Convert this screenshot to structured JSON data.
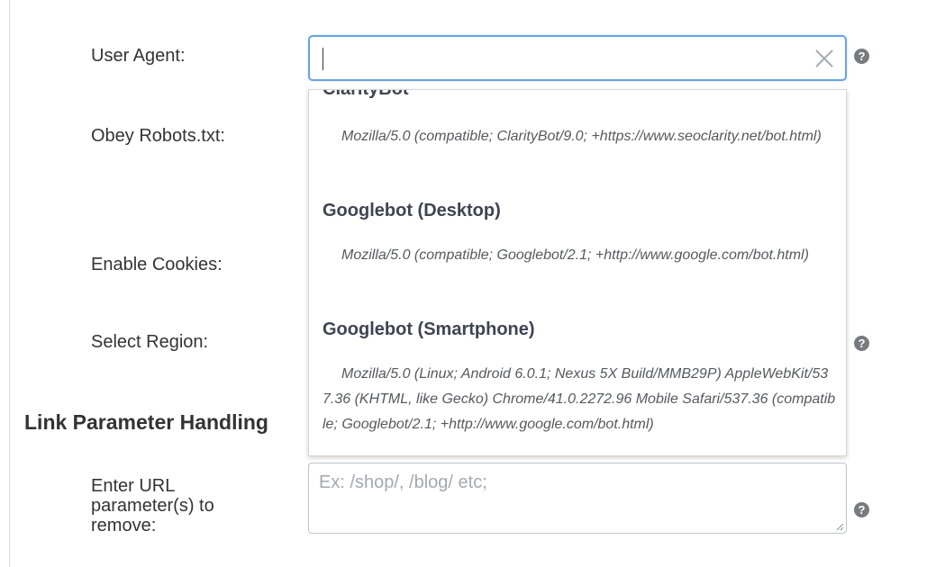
{
  "labels": {
    "user_agent": "User Agent:",
    "obey_robots": "Obey Robots.txt:",
    "enable_cookies": "Enable Cookies:",
    "select_region": "Select Region:",
    "url_params": "Enter URL parameter(s) to remove:"
  },
  "section": {
    "link_parameter_handling": "Link Parameter Handling"
  },
  "user_agent_input": {
    "value": ""
  },
  "dropdown": {
    "options": [
      {
        "title": "ClarityBot",
        "description": "Mozilla/5.0 (compatible; ClarityBot/9.0; +https://www.seoclarity.net/bot.html)"
      },
      {
        "title": "Googlebot (Desktop)",
        "description": "Mozilla/5.0 (compatible; Googlebot/2.1; +http://www.google.com/bot.html)"
      },
      {
        "title": "Googlebot (Smartphone)",
        "description": "Mozilla/5.0 (Linux; Android 6.0.1; Nexus 5X Build/MMB29P) AppleWebKit/537.36 (KHTML, like Gecko) Chrome/41.0.2272.96 Mobile Safari/537.36 (compatible; Googlebot/2.1; +http://www.google.com/bot.html)"
      }
    ]
  },
  "url_params_field": {
    "placeholder": "Ex: /shop/, /blog/ etc;"
  },
  "help_icon_glyph": "?",
  "icons": {
    "clear": "close-icon",
    "help": "question-circle-icon"
  },
  "colors": {
    "focus_border": "#66a2e6",
    "help_icon": "#777b80"
  }
}
